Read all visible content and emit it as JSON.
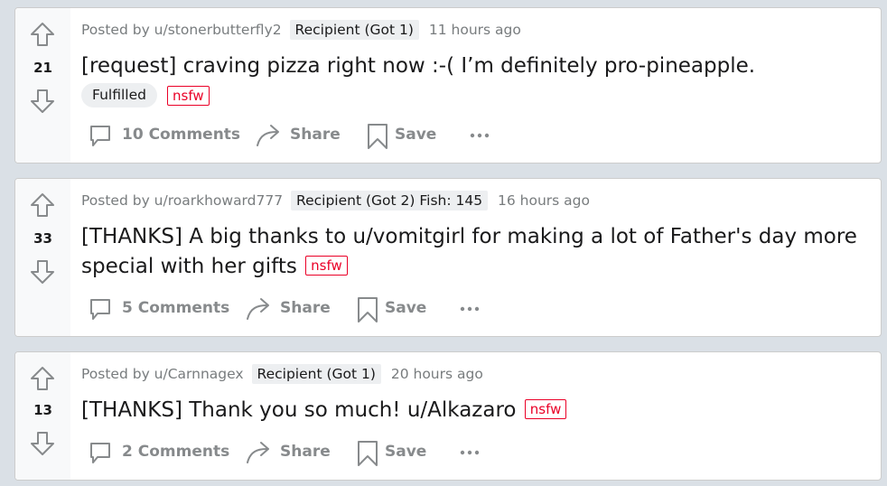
{
  "posts": [
    {
      "score": "21",
      "posted_by": "Posted by u/stonerbutterfly2",
      "flair": "Recipient (Got 1)",
      "time": "11 hours ago",
      "title": "[request] craving pizza right now :-( I’m definitely pro-pineapple.",
      "link_flair": "Fulfilled",
      "nsfw": "nsfw",
      "comments": "10 Comments",
      "share": "Share",
      "save": "Save"
    },
    {
      "score": "33",
      "posted_by": "Posted by u/roarkhoward777",
      "flair": "Recipient (Got 2) Fish: 145",
      "time": "16 hours ago",
      "title": "[THANKS] A big thanks to u/vomitgirl for making a lot of Father's day more special with her gifts",
      "nsfw": "nsfw",
      "comments": "5 Comments",
      "share": "Share",
      "save": "Save"
    },
    {
      "score": "13",
      "posted_by": "Posted by u/Carnnagex",
      "flair": "Recipient (Got 1)",
      "time": "20 hours ago",
      "title": "[THANKS] Thank you so much! u/Alkazaro",
      "nsfw": "nsfw",
      "comments": "2 Comments",
      "share": "Share",
      "save": "Save"
    }
  ],
  "icons": {
    "upvote": "arrow-up-icon",
    "downvote": "arrow-down-icon",
    "comment": "comment-bubble-icon",
    "share": "share-arrow-icon",
    "save": "bookmark-icon",
    "more": "more-dots-icon"
  },
  "colors": {
    "page_bg": "#dae0e6",
    "nsfw": "#ea0027",
    "muted": "#878a8c"
  }
}
